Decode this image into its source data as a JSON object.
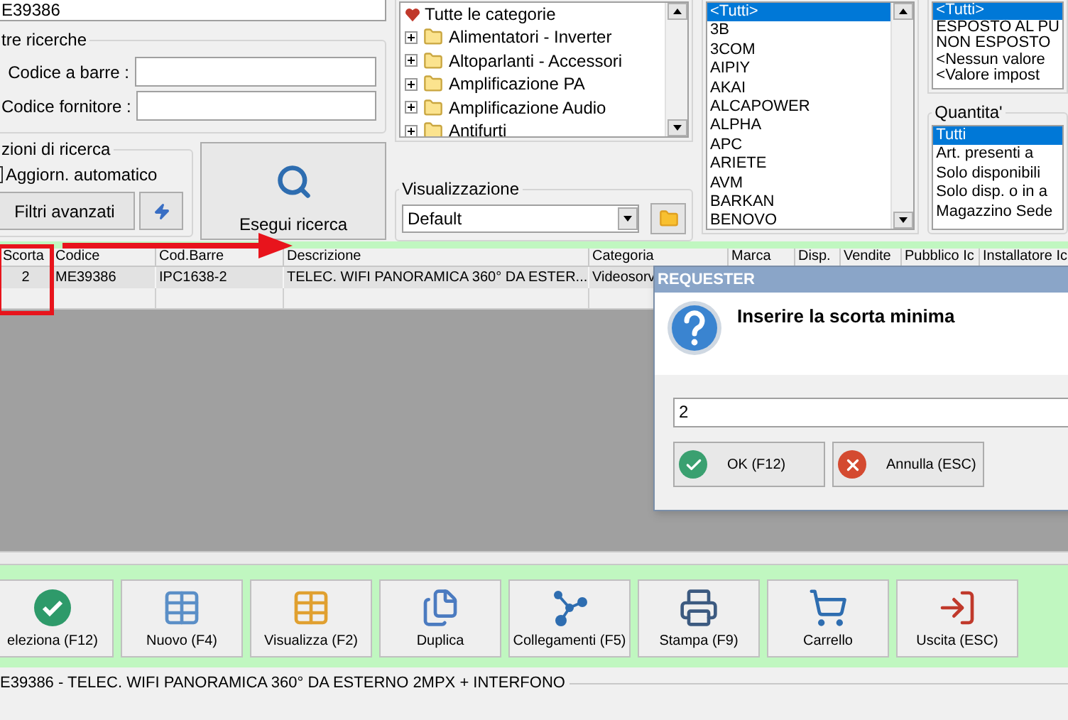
{
  "search": {
    "code_value": "E39386"
  },
  "other_searches": {
    "title": "tre ricerche",
    "fields": [
      {
        "label": "Codice a barre :"
      },
      {
        "label": "Codice fornitore :"
      }
    ]
  },
  "search_options": {
    "title": "zioni di ricerca",
    "auto_update_checked": false,
    "auto_update_label": "Aggiorn. automatico",
    "advanced_filters_button": "Filtri avanzati"
  },
  "search_button": "Esegui ricerca",
  "category_tree": {
    "root": "Tutte le categorie",
    "children": [
      {
        "label": "Alimentatori - Inverter",
        "expanded": false
      },
      {
        "label": "Altoparlanti - Accessori",
        "expanded": false
      },
      {
        "label": "Amplificazione PA",
        "expanded": false
      },
      {
        "label": "Amplificazione Audio",
        "expanded": false
      },
      {
        "label": "Antifurti",
        "expanded": false
      }
    ]
  },
  "view": {
    "title": "Visualizzazione",
    "value": "Default"
  },
  "brands": [
    {
      "label": "<Tutti>",
      "selected": true
    },
    {
      "label": "3B",
      "selected": false
    },
    {
      "label": "3COM",
      "selected": false
    },
    {
      "label": "AIPIY",
      "selected": false
    },
    {
      "label": "AKAI",
      "selected": false
    },
    {
      "label": "ALCAPOWER",
      "selected": false
    },
    {
      "label": "ALPHA",
      "selected": false
    },
    {
      "label": "APC",
      "selected": false
    },
    {
      "label": "ARIETE",
      "selected": false
    },
    {
      "label": "AVM",
      "selected": false
    },
    {
      "label": "BARKAN",
      "selected": false
    },
    {
      "label": "BENOVO",
      "selected": false
    }
  ],
  "display_filter": [
    {
      "label": "<Tutti>",
      "selected": true
    },
    {
      "label": "ESPOSTO AL PU",
      "selected": false
    },
    {
      "label": "NON ESPOSTO",
      "selected": false
    },
    {
      "label": "<Nessun valore",
      "selected": false
    },
    {
      "label": "<Valore impost",
      "selected": false
    }
  ],
  "quantity": {
    "title": "Quantita'",
    "options": [
      {
        "label": "Tutti",
        "selected": true
      },
      {
        "label": "Art. presenti a",
        "selected": false
      },
      {
        "label": "Solo disponibili",
        "selected": false
      },
      {
        "label": "Solo disp. o in a",
        "selected": false
      },
      {
        "label": "Magazzino Sede",
        "selected": false
      }
    ]
  },
  "table": {
    "columns": [
      "Scorta",
      "Codice",
      "Cod.Barre",
      "Descrizione",
      "Categoria",
      "Marca",
      "Disp.",
      "Vendite",
      "Pubblico Ic",
      "Installatore Ic"
    ],
    "rows": [
      {
        "cells": [
          "2",
          "ME39386",
          "IPC1638-2",
          "TELEC. WIFI PANORAMICA 360° DA ESTER...",
          "Videosorv"
        ]
      }
    ]
  },
  "dialog": {
    "title": "REQUESTER",
    "message": "Inserire la scorta minima",
    "value": "2",
    "buttons": [
      {
        "kind": "ok",
        "label": "OK (F12)"
      },
      {
        "kind": "cancel",
        "label": "Annulla (ESC)"
      }
    ]
  },
  "toolbar": [
    {
      "kind": "select",
      "label": "eleziona (F12)"
    },
    {
      "kind": "new",
      "label": "Nuovo (F4)"
    },
    {
      "kind": "view",
      "label": "Visualizza (F2)"
    },
    {
      "kind": "duplicate",
      "label": "Duplica"
    },
    {
      "kind": "links",
      "label": "Collegamenti (F5)"
    },
    {
      "kind": "print",
      "label": "Stampa (F9)"
    },
    {
      "kind": "cart",
      "label": "Carrello"
    },
    {
      "kind": "exit",
      "label": "Uscita (ESC)"
    }
  ],
  "status_text": "E39386 - TELEC. WIFI PANORAMICA 360° DA ESTERNO 2MPX + INTERFONO"
}
